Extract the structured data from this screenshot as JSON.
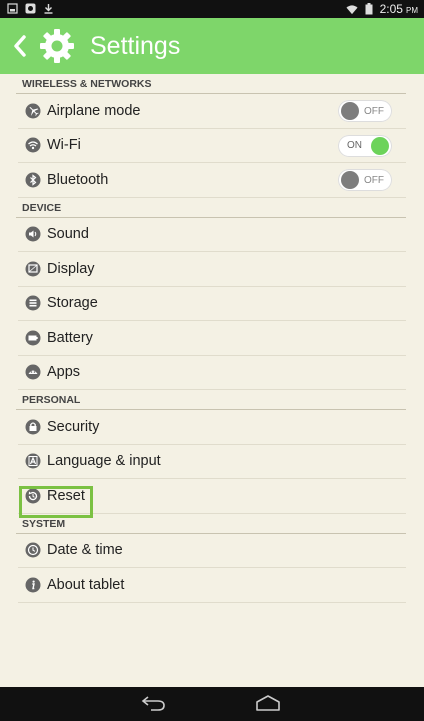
{
  "status_bar": {
    "time": "2:05",
    "ampm": "PM",
    "left_icons": [
      "screenshot-icon",
      "app-icon",
      "download-icon"
    ],
    "right_icons": [
      "wifi-icon",
      "battery-icon"
    ]
  },
  "action_bar": {
    "title": "Settings",
    "icons": [
      "back-chevron-icon",
      "settings-gear-icon"
    ]
  },
  "sections": [
    {
      "header": "WIRELESS & NETWORKS",
      "items": [
        {
          "label": "Airplane mode",
          "icon": "airplane-icon",
          "toggle": "OFF"
        },
        {
          "label": "Wi-Fi",
          "icon": "wifi-icon",
          "toggle": "ON"
        },
        {
          "label": "Bluetooth",
          "icon": "bluetooth-icon",
          "toggle": "OFF"
        }
      ]
    },
    {
      "header": "DEVICE",
      "items": [
        {
          "label": "Sound",
          "icon": "sound-icon"
        },
        {
          "label": "Display",
          "icon": "display-icon"
        },
        {
          "label": "Storage",
          "icon": "storage-icon"
        },
        {
          "label": "Battery",
          "icon": "battery-icon"
        },
        {
          "label": "Apps",
          "icon": "apps-icon"
        }
      ]
    },
    {
      "header": "PERSONAL",
      "items": [
        {
          "label": "Security",
          "icon": "lock-icon"
        },
        {
          "label": "Language & input",
          "icon": "language-icon"
        },
        {
          "label": "Reset",
          "icon": "reset-icon",
          "highlighted": true
        }
      ]
    },
    {
      "header": "SYSTEM",
      "items": [
        {
          "label": "Date & time",
          "icon": "clock-icon"
        },
        {
          "label": "About tablet",
          "icon": "info-icon"
        }
      ]
    }
  ],
  "colors": {
    "action_bar": "#7ed66a",
    "background": "#f4f1e4",
    "toggle_on": "#6cd35a",
    "highlight": "#7bc142"
  },
  "nav_bar": {
    "icons": [
      "nav-back-icon",
      "nav-home-icon"
    ]
  }
}
